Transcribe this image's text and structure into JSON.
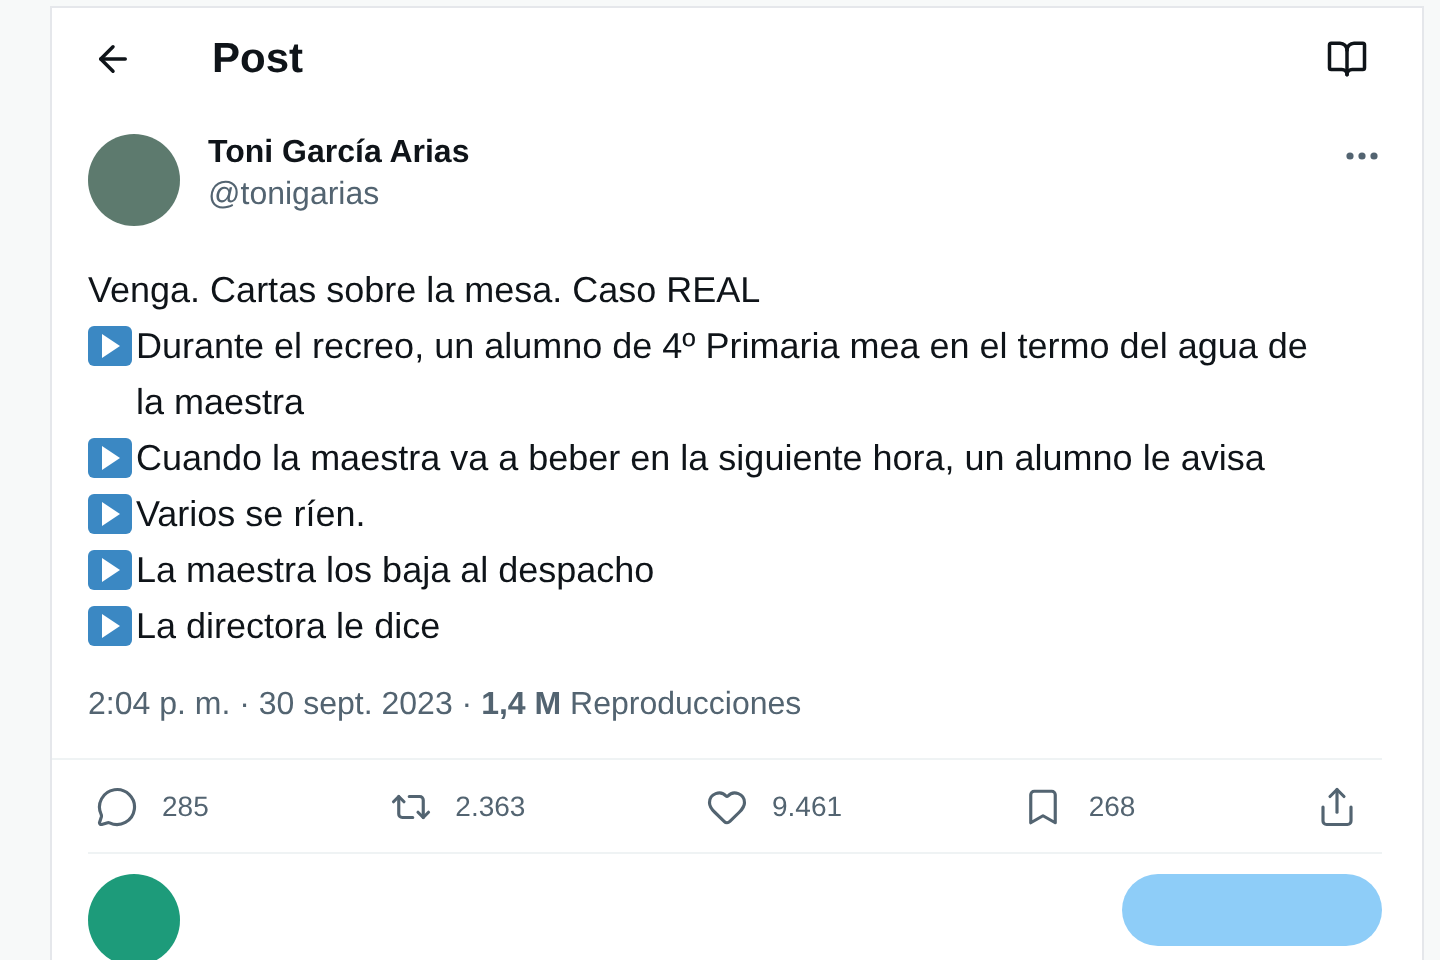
{
  "header": {
    "title": "Post"
  },
  "author": {
    "name": "Toni García Arias",
    "handle": "@tonigarias"
  },
  "body": [
    {
      "kind": "plain",
      "text": "Venga. Cartas sobre la mesa. Caso REAL"
    },
    {
      "kind": "bullet",
      "text": "Durante el recreo, un alumno de 4º Primaria mea en el termo del agua de la maestra"
    },
    {
      "kind": "bullet",
      "text": "Cuando la maestra va a beber en la siguiente hora, un alumno le avisa"
    },
    {
      "kind": "bullet",
      "text": "Varios se ríen."
    },
    {
      "kind": "bullet",
      "text": "La maestra los baja al despacho"
    },
    {
      "kind": "bullet",
      "text": "La directora le dice"
    }
  ],
  "meta": "2:04 p. m. · 30 sept. 2023 · **1,4 M** Reproducciones",
  "actions": [
    {
      "kind": "reply",
      "count": "285"
    },
    {
      "kind": "repost",
      "count": "2.363"
    },
    {
      "kind": "like",
      "count": "9.461"
    },
    {
      "kind": "bookmark",
      "count": "268"
    },
    {
      "kind": "share"
    }
  ]
}
